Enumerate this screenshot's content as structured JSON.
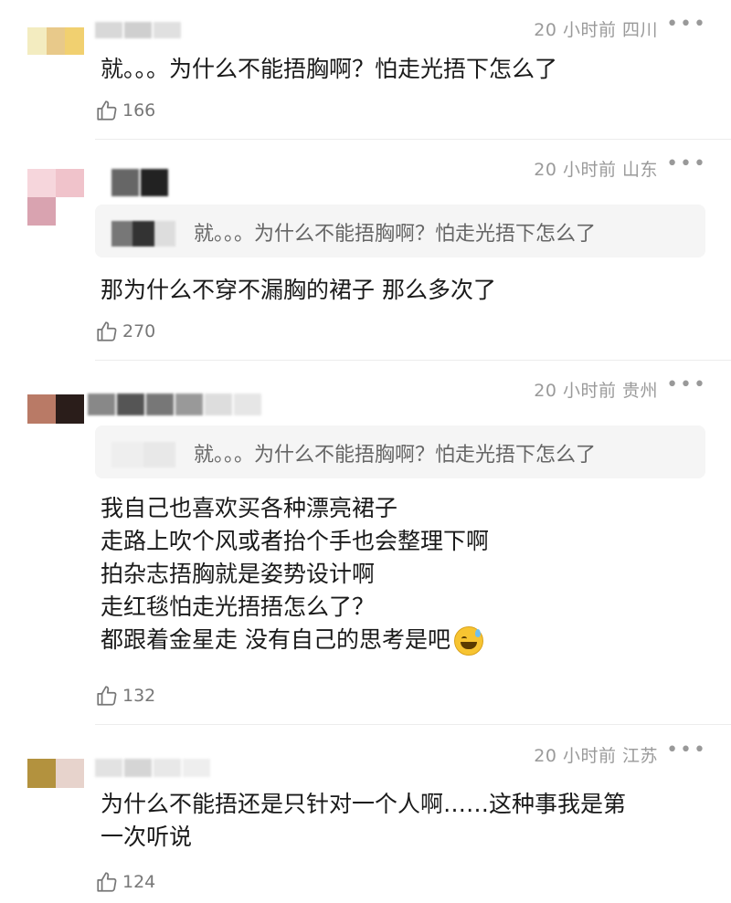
{
  "comments": [
    {
      "meta": "20 小时前 四川",
      "more": "•••",
      "lines": [
        "就。。。为什么不能捂胸啊？怕走光捂下怎么了"
      ],
      "likes": "166"
    },
    {
      "meta": "20 小时前 山东",
      "more": "•••",
      "quote": "就。。。为什么不能捂胸啊？怕走光捂下怎么了",
      "lines": [
        "那为什么不穿不漏胸的裙子  那么多次了"
      ],
      "likes": "270"
    },
    {
      "meta": "20 小时前 贵州",
      "more": "•••",
      "quote": "就。。。为什么不能捂胸啊？怕走光捂下怎么了",
      "lines": [
        "我自己也喜欢买各种漂亮裙子",
        "走路上吹个风或者抬个手也会整理下啊",
        "拍杂志捂胸就是姿势设计啊",
        "走红毯怕走光捂捂怎么了？",
        "都跟着金星走 没有自己的思考是吧"
      ],
      "emoji": "sweat-smile-emoji",
      "likes": "132"
    },
    {
      "meta": "20 小时前 江苏",
      "more": "•••",
      "lines": [
        "为什么不能捂还是只针对一个人啊……这种事我是第",
        "一次听说"
      ],
      "likes": "124"
    }
  ],
  "colors": {
    "meta_text": "#9a9a9a",
    "quote_bg": "#f5f5f5",
    "divider": "#ececec"
  }
}
